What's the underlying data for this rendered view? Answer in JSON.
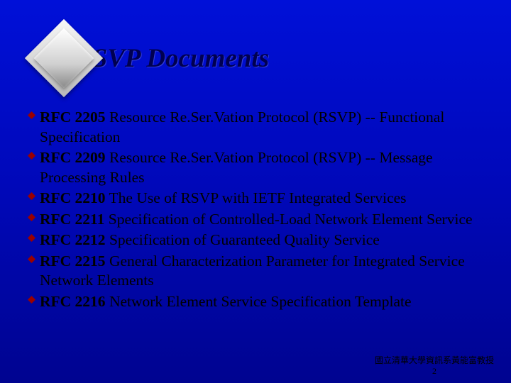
{
  "title": "RSVP Documents",
  "items": [
    {
      "label": "RFC 2205",
      "rest": " Resource Re.Ser.Vation Protocol (RSVP) -- Functional Specification"
    },
    {
      "label": "RFC 2209",
      "rest": " Resource Re.Ser.Vation Protocol (RSVP) -- Message Processing Rules"
    },
    {
      "label": "RFC 2210",
      "rest": " The Use of RSVP with IETF Integrated Services"
    },
    {
      "label": "RFC 2211",
      "rest": " Specification of Controlled-Load Network Element Service"
    },
    {
      "label": "RFC 2212",
      "rest": " Specification of Guaranteed Quality Service"
    },
    {
      "label": "RFC 2215",
      "rest": " General Characterization Parameter for Integrated Service Network Elements"
    },
    {
      "label": "RFC 2216",
      "rest": " Network Element Service Specification Template"
    }
  ],
  "footer": {
    "attribution": "國立清華大學資訊系黃能富教授",
    "page": "2"
  }
}
